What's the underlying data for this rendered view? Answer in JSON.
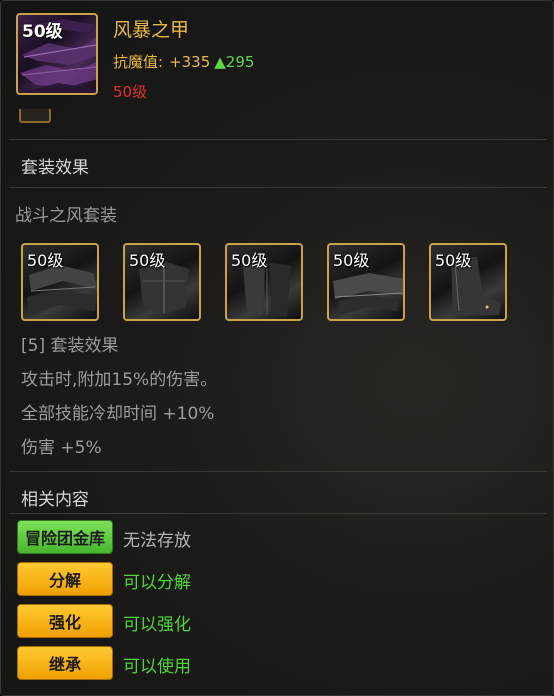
{
  "item": {
    "level_badge": "50级",
    "name": "风暴之甲",
    "stat_label": "抗魔值:",
    "stat_value": "+335",
    "stat_up": "▲295",
    "required_level": "50级",
    "icon": "purple-armor-icon"
  },
  "set_effect": {
    "section_title": "套装效果",
    "set_name": "战斗之风套装",
    "pieces": [
      {
        "level": "50级",
        "icon": "black-shoulder-armor-icon"
      },
      {
        "level": "50级",
        "icon": "black-chest-armor-icon"
      },
      {
        "level": "50级",
        "icon": "black-leg-armor-icon"
      },
      {
        "level": "50级",
        "icon": "black-belt-armor-icon"
      },
      {
        "level": "50级",
        "icon": "black-boots-armor-icon"
      }
    ],
    "effects": [
      "[5] 套装效果",
      "攻击时,附加15%的伤害。",
      "全部技能冷却时间 +10%",
      "伤害 +5%"
    ]
  },
  "related": {
    "section_title": "相关内容",
    "rows": [
      {
        "tag": "冒险团金库",
        "text": "无法存放"
      },
      {
        "tag": "分解",
        "text": "可以分解"
      },
      {
        "tag": "强化",
        "text": "可以强化"
      },
      {
        "tag": "继承",
        "text": "可以使用"
      }
    ]
  },
  "colors": {
    "gold": "#e8b84a",
    "red": "#e0332f",
    "green": "#4fd63a",
    "tag_green": "#5cc93a",
    "tag_gold": "#f5b000"
  }
}
